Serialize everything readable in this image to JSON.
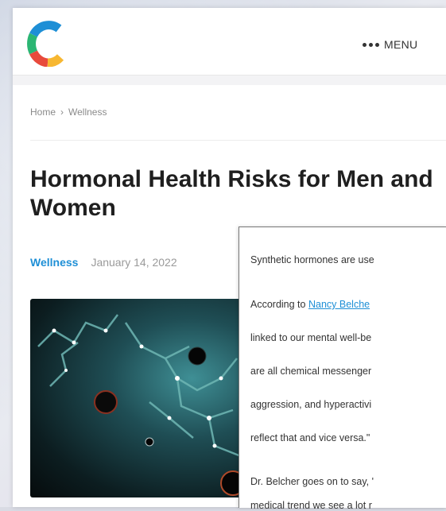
{
  "header": {
    "menu_label": "MENU"
  },
  "breadcrumb": {
    "home": "Home",
    "separator": "›",
    "current": "Wellness"
  },
  "article": {
    "title": "Hormonal Health Risks for Men and Women",
    "category": "Wellness",
    "date": "January 14, 2022"
  },
  "popup": {
    "line1": "Synthetic hormones are use",
    "line2_prefix": "According to ",
    "line2_link": "Nancy Belche",
    "line3": "linked to our mental well-be",
    "line4": "are all chemical messenger",
    "line5": "aggression, and hyperactivi",
    "line6": "reflect that and vice versa.\"",
    "line7": "Dr. Belcher goes on to say, '",
    "line8": "medical trend we see a lot r"
  },
  "colors": {
    "accent": "#1e8fd6",
    "logo_colors": [
      "#1e8fd6",
      "#2bb673",
      "#f7b731",
      "#e84a3c"
    ]
  },
  "icons": {
    "menu": "three-dots-icon",
    "logo": "c-ring-logo"
  }
}
